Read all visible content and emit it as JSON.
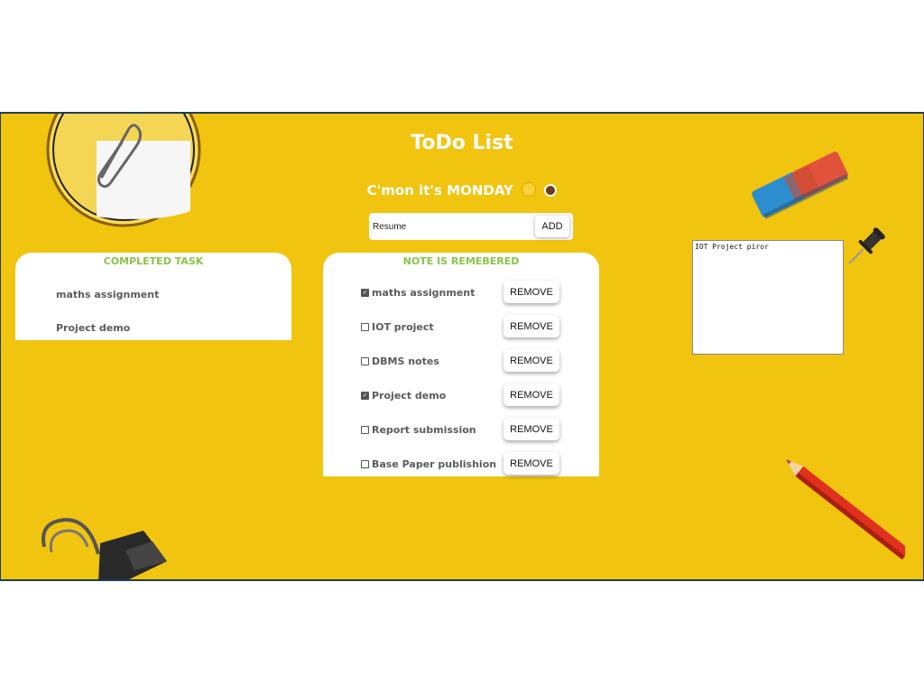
{
  "app": {
    "title": "ToDo List",
    "subtitle": "C'mon it's MONDAY",
    "colors": {
      "background": "#f1c40f",
      "accent_green": "#8bc34a",
      "text_gray": "#5b5b5b"
    }
  },
  "input": {
    "value": "Resume",
    "add_label": "ADD"
  },
  "completed": {
    "title": "COMPLETED TASK",
    "items": [
      "maths assignment",
      "Project demo"
    ]
  },
  "notes": {
    "title": "NOTE IS REMEBERED",
    "remove_label": "REMOVE",
    "items": [
      {
        "label": "maths assignment",
        "checked": true
      },
      {
        "label": "IOT project",
        "checked": false
      },
      {
        "label": "DBMS notes",
        "checked": false
      },
      {
        "label": "Project demo",
        "checked": true
      },
      {
        "label": "Report submission",
        "checked": false
      },
      {
        "label": "Base Paper publishion",
        "checked": false
      }
    ]
  },
  "memo": {
    "text": "IOT Project piror"
  },
  "decorations": [
    "paperclip-icon",
    "eraser-icon",
    "pushpin-icon",
    "binder-clip-icon",
    "pencil-icon"
  ]
}
